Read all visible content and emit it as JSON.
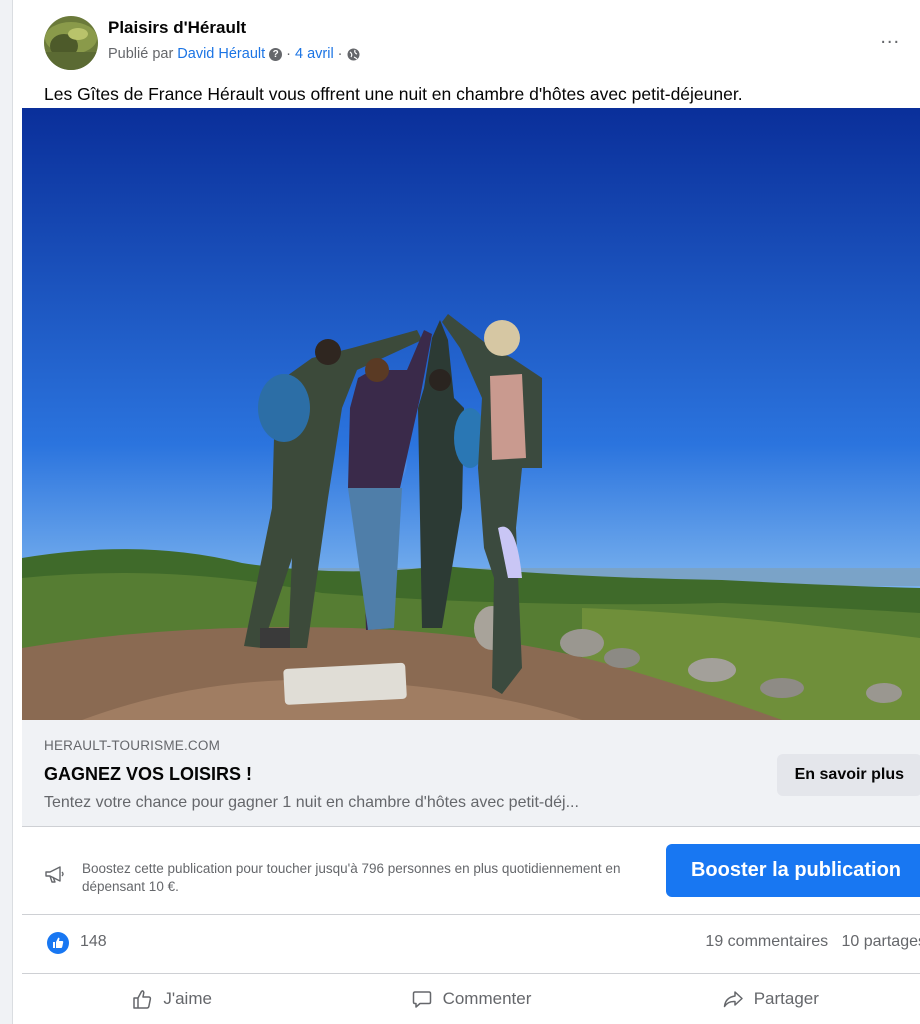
{
  "post": {
    "page_name": "Plaisirs d'Hérault",
    "published_prefix": "Publié par",
    "author": "David Hérault",
    "separator": "·",
    "date": "4 avril",
    "more_label": "...",
    "text": "Les Gîtes de France Hérault vous offrent une nuit en chambre d'hôtes avec petit-déjeuner."
  },
  "link_preview": {
    "domain": "HERAULT-TOURISME.COM",
    "title": "GAGNEZ VOS LOISIRS !",
    "description": "Tentez votre chance pour gagner 1 nuit en chambre d'hôtes avec petit-déj...",
    "cta_label": "En savoir plus"
  },
  "boost": {
    "text": "Boostez cette publication pour toucher jusqu'à 796 personnes en plus quotidiennement en dépensant 10 €.",
    "button_label": "Booster la publication"
  },
  "stats": {
    "likes": "148",
    "comments": "19 commentaires",
    "shares": "10 partages"
  },
  "actions": {
    "like": "J'aime",
    "comment": "Commenter",
    "share": "Partager"
  },
  "colors": {
    "accent": "#1877f2",
    "link": "#1b74e4",
    "secondary_text": "#65676b"
  }
}
